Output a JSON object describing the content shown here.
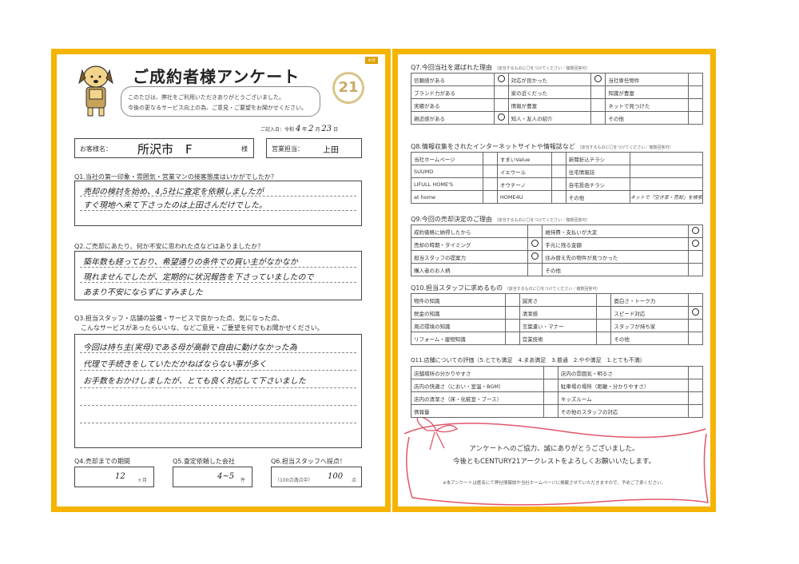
{
  "header": {
    "title": "ご成約者様アンケート",
    "intro_line1": "このたびは、弊社をご利用いただきありがとうございました。",
    "intro_line2": "今後の更なるサービス向上の為、ご意見・ご要望をお聞かせください。",
    "logo_text": "21",
    "badge": "大日",
    "date_label": "ご記入日：令和",
    "date_year": "4",
    "date_year_unit": "年",
    "date_month": "2",
    "date_month_unit": "月",
    "date_day": "23",
    "date_day_unit": "日"
  },
  "customer": {
    "name_label": "お客様名：",
    "name_value": "所沢市　F",
    "honorific": "様",
    "staff_label": "営業担当：",
    "staff_value": "上田"
  },
  "q1": {
    "label": "Q1.当社の第一印象・雰囲気・営業マンの接客態度はいかがでしたか？",
    "answer_line1": "売却の検討を始め、4,5社に査定を依頼しましたが",
    "answer_line2": "すぐ現地へ来て下さったのは上田さんだけでした。"
  },
  "q2": {
    "label": "Q2.ご売却にあたり、何か不安に思われた点などはありましたか？",
    "answer_line1": "築年数も経っており、希望通りの条件での買い主がなかなか",
    "answer_line2": "現れませんでしたが、定期的に状況報告を下さっていましたので",
    "answer_line3": "あまり不安にならずにすみました"
  },
  "q3": {
    "label_line1": "Q3.担当スタッフ・店舗の設備・サービスで良かった点、気になった点、",
    "label_line2": "こんなサービスがあったらいいな、などご意見・ご要望を何でもお聞かせください。",
    "answer_line1": "今回は持ち主(実母)である母が高齢で自由に動けなかった為",
    "answer_line2": "代理で手続きをしていただかねばならない事が多く",
    "answer_line3": "お手数をおかけしましたが、とても良く対応して下さいました"
  },
  "q4": {
    "label": "Q4.売却までの期間",
    "value": "12",
    "unit": "ヶ月"
  },
  "q5": {
    "label": "Q5.査定依頼した会社",
    "value": "4~5",
    "unit": "件"
  },
  "q6": {
    "label": "Q6.担当スタッフへ採点！",
    "prefix": "（100点満点中）",
    "value": "100",
    "unit": "点"
  },
  "q7": {
    "label": "Q7.今回当社を選ばれた理由",
    "hint": "（該当するものに〇をつけてください／複数回答可）",
    "rows": [
      [
        "信頼感がある",
        "〇",
        "対応が良かった",
        "〇",
        "当社専任物件",
        ""
      ],
      [
        "ブランド力がある",
        "",
        "家の近くだった",
        "",
        "知識が豊富",
        ""
      ],
      [
        "実績がある",
        "",
        "情報が豊富",
        "",
        "ネットで見つけた",
        ""
      ],
      [
        "親近感がある",
        "〇",
        "知人・友人の紹介",
        "",
        "その他",
        ""
      ]
    ]
  },
  "q8": {
    "label": "Q8.情報収集をされたインターネットサイトや情報誌など",
    "hint": "（該当するものに〇をつけてください／複数回答可）",
    "rows": [
      [
        "当社ホームページ",
        "",
        "すまいValue",
        "",
        "新聞折込チラシ",
        ""
      ],
      [
        "SUUMO",
        "",
        "イエウール",
        "",
        "住宅情報誌",
        ""
      ],
      [
        "LIFULL HOME'S",
        "",
        "オウチーノ",
        "",
        "自宅投函チラシ",
        ""
      ],
      [
        "at home",
        "",
        "HOME4U",
        "",
        "その他",
        "ネットで「空き家・売却」を検索"
      ]
    ]
  },
  "q9": {
    "label": "Q9.今回の売却決定のご理由",
    "hint": "（該当するものに〇をつけてください／複数回答可）",
    "rows": [
      [
        "成約価格に納得したから",
        "",
        "維持費・支払いが大変",
        "〇"
      ],
      [
        "売却の時期・タイミング",
        "〇",
        "手元に残る金額",
        "〇"
      ],
      [
        "担当スタッフの提案力",
        "〇",
        "住み替え先の物件が見つかった",
        ""
      ],
      [
        "購入者のお人柄",
        "",
        "その他",
        ""
      ]
    ]
  },
  "q10": {
    "label": "Q10.担当スタッフに求めるもの",
    "hint": "（該当するものに〇をつけてください／複数回答可）",
    "rows": [
      [
        "物件の知識",
        "",
        "誠実さ",
        "",
        "面白さ・トーク力",
        ""
      ],
      [
        "税金の知識",
        "",
        "清潔感",
        "",
        "スピード対応",
        "〇"
      ],
      [
        "周辺環境の知識",
        "",
        "言葉遣い・マナー",
        "",
        "スタッフが持ち家",
        ""
      ],
      [
        "リフォーム・建物知識",
        "",
        "営業技術",
        "",
        "その他",
        ""
      ]
    ]
  },
  "q11": {
    "label": "Q11.店舗についての評価（5.とても満足　4.まあ満足　3.普通　2.やや満足　1.とても不満）",
    "rows": [
      [
        "店舗場所の分かりやすさ",
        "",
        "店内の雰囲気・明るさ",
        ""
      ],
      [
        "店内の快適さ（におい・室温・BGM）",
        "",
        "駐車場の場所（距離・分かりやすさ）",
        ""
      ],
      [
        "店内の清潔さ（床・化粧室・ブース）",
        "",
        "キッズルーム",
        ""
      ],
      [
        "情報量",
        "",
        "その他のスタッフの対応",
        ""
      ]
    ]
  },
  "footer": {
    "thanks_line1": "アンケートへのご協力、誠にありがとうございました。",
    "thanks_line2": "今後ともCENTURY21アークレストをよろしくお願いいたします。",
    "note": "※本アンケートは匿名にて弊社情報誌や当社ホームページに掲載させていただきますので、予めご了承ください。"
  },
  "colors": {
    "frame": "#f4b400",
    "ribbon": "#e0566a"
  }
}
